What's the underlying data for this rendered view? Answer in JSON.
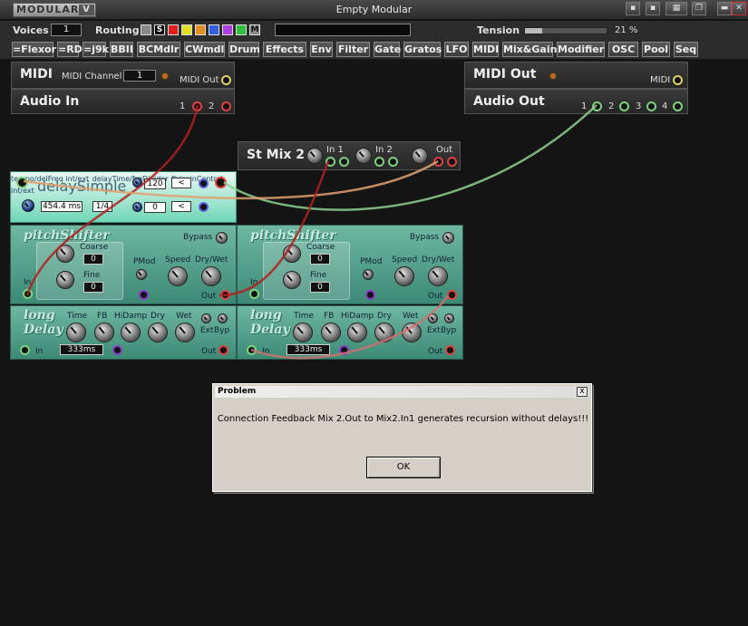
{
  "app": {
    "logo": "MODULAR",
    "logo_mark": "V",
    "title": "Empty Modular"
  },
  "controls": {
    "voices_label": "Voices",
    "voices_value": "1",
    "routing_label": "Routing",
    "routing_selected": "S",
    "routing_last": "M",
    "routing_colors": [
      "#888888",
      "#000000",
      "#e02020",
      "#e0e020",
      "#e09020",
      "#3060e0",
      "#b040e0",
      "#30c040",
      "#888888"
    ],
    "tension_label": "Tension",
    "tension_value": 0.21,
    "tension_text": "21 %"
  },
  "categories": [
    "=Flexor",
    "=RD",
    "=j9k",
    "BBII",
    "BCMdlr",
    "CWmdl",
    "Drum",
    "Effects",
    "Env",
    "Filter",
    "Gate",
    "Gratos",
    "LFO",
    "MIDI",
    "Mix&Gain",
    "Modifier",
    "OSC",
    "Pool",
    "Seq"
  ],
  "modules": {
    "midi": {
      "title": "MIDI",
      "channel_label": "MIDI Channel",
      "channel_value": "1",
      "out_label": "MIDI Out"
    },
    "audio_in": {
      "title": "Audio In",
      "port1": "1",
      "port2": "2"
    },
    "midi_out": {
      "title": "MIDI Out",
      "port_label": "MIDI"
    },
    "audio_out": {
      "title": "Audio Out",
      "ports": [
        "1",
        "2",
        "3",
        "4"
      ]
    },
    "st_mix": {
      "title": "St Mix 2",
      "in1": "In 1",
      "in2": "In 2",
      "out": "Out"
    },
    "delay_simple": {
      "title": "delaySimple",
      "tempo_value": "120",
      "tempo_btn": "<",
      "tempo_label": "tempo/delFreq int/ext",
      "freq_value": "454.4 ms",
      "ratio_value": "1/4",
      "fb_value": "0",
      "fb_btn": "<",
      "delay_label": "delayTime/frqDivider",
      "fb_label": "fb/gainControl int/ext"
    },
    "pitch_shifter": {
      "title": "pitchShifter",
      "bypass": "Bypass",
      "coarse": "Coarse",
      "coarse_value": "0",
      "fine": "Fine",
      "fine_value": "0",
      "pmod": "PMod",
      "speed": "Speed",
      "drywet": "Dry/Wet",
      "in": "In",
      "out": "Out"
    },
    "long_delay": {
      "title_top": "long",
      "title_bottom": "Delay",
      "time": "Time",
      "fb": "FB",
      "hidamp": "HiDamp",
      "dry": "Dry",
      "wet": "Wet",
      "ext": "Ext",
      "byp": "Byp",
      "time_value": "333ms",
      "in": "In",
      "out": "Out"
    }
  },
  "dialog": {
    "title": "Problem",
    "close": "x",
    "message": "Connection Feedback Mix 2.Out to Mix2.In1 generates recursion without delays!!!",
    "ok": "OK"
  }
}
